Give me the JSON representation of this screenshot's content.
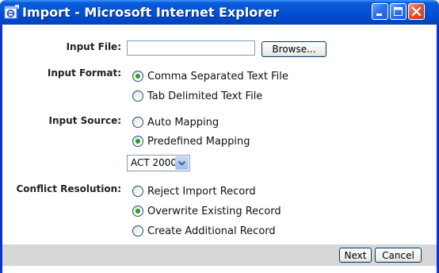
{
  "window": {
    "title": "Import - Microsoft Internet Explorer"
  },
  "form": {
    "input_file": {
      "label": "Input File:",
      "value": "",
      "browse_label": "Browse..."
    },
    "input_format": {
      "label": "Input Format:",
      "options": [
        {
          "label": "Comma Separated Text File",
          "checked": true
        },
        {
          "label": "Tab Delimited Text File",
          "checked": false
        }
      ]
    },
    "input_source": {
      "label": "Input Source:",
      "options": [
        {
          "label": "Auto Mapping",
          "checked": false
        },
        {
          "label": "Predefined Mapping",
          "checked": true
        }
      ],
      "mapping_select": "ACT 2000"
    },
    "conflict_resolution": {
      "label": "Conflict Resolution:",
      "options": [
        {
          "label": "Reject Import Record",
          "checked": false
        },
        {
          "label": "Overwrite Existing Record",
          "checked": true
        },
        {
          "label": "Create Additional Record",
          "checked": false
        }
      ]
    }
  },
  "footer": {
    "next_label": "Next",
    "cancel_label": "Cancel"
  }
}
